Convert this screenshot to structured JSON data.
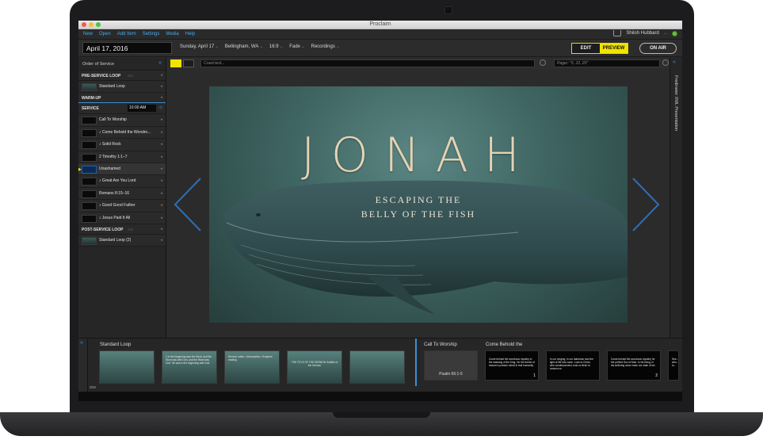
{
  "window": {
    "title": "Proclaim"
  },
  "menu": [
    "New",
    "Open",
    "Add Item",
    "Settings",
    "Media",
    "Help"
  ],
  "user": {
    "name": "Shiloh Hubbard"
  },
  "toolbar": {
    "date": "April 17, 2016",
    "service_date": "Sunday, April 17",
    "location": "Bellingham, WA",
    "aspect": "16:9",
    "transition": "Fade",
    "recordings": "Recordings",
    "edit_label": "EDIT",
    "preview_label": "PREVIEW",
    "onair_label": "ON AIR"
  },
  "sidebar": {
    "title": "Order of Service",
    "sections": {
      "pre": {
        "label": "PRE-SERVICE LOOP",
        "count": "45s"
      },
      "warmup": {
        "label": "WARM-UP"
      },
      "service": {
        "label": "SERVICE",
        "time": "10:00 AM"
      },
      "post": {
        "label": "POST-SERVICE LOOP",
        "count": "45s"
      }
    },
    "pre_items": [
      {
        "label": "Standard Loop",
        "count": "45s"
      }
    ],
    "service_items": [
      {
        "label": "Call To Worship"
      },
      {
        "label": "♪ Come Behold the Wondro..."
      },
      {
        "label": "♪ Solid Rock"
      },
      {
        "label": "2 Timothy 1:1–7"
      },
      {
        "label": "Unashamed"
      },
      {
        "label": "♪ Great Are You Lord"
      },
      {
        "label": "Romans 8:15–16"
      },
      {
        "label": "♪ Good Good Father"
      },
      {
        "label": "♪ Jesus Paid It All"
      }
    ],
    "post_items": [
      {
        "label": "Standard Loop (2)",
        "count": "45s"
      }
    ]
  },
  "preview_toolbar": {
    "crawl_placeholder": "Crawl text...",
    "pager_placeholder": "Pager: \"5, 10, 20\""
  },
  "slide": {
    "title": "JONAH",
    "subtitle_line1": "ESCAPING THE",
    "subtitle_line2": "BELLY OF THE FISH"
  },
  "right_panel": {
    "label": "Fredmeier XML Presentation"
  },
  "bottom": {
    "group1_label": "Standard Loop",
    "group2_label": "Call To Worship",
    "group3_label": "Come Behold the",
    "loop_thumbs": [
      {
        "text": ""
      },
      {
        "text": "1 In the beginning was the Word, and the Word was with God, and the Word was God. He was in the beginning with God."
      },
      {
        "text": "Sermon notes: • Introduction • Scripture reading"
      },
      {
        "text": "THE TITLE OF THE SERMON Subtitle of the Sermon"
      },
      {
        "text": ""
      }
    ],
    "service_thumbs": [
      {
        "text": "",
        "caption": "Psalm 66:1-5",
        "num": ""
      },
      {
        "text": "Come behold the wondrous mystery in the dawning of the King. He the theme of heaven's praises robed in frail humanity",
        "caption": "",
        "num": "1"
      },
      {
        "text": "In our longing, in our darkness now the light of life has come. Look to Christ, who condescended, took on flesh to ransom us",
        "caption": "",
        "num": ""
      },
      {
        "text": "Come behold the wondrous mystery he the perfect Son of Man. In his living, in his suffering never trace nor stain of sin",
        "caption": "",
        "num": "2"
      },
      {
        "text": "See... who... lo...",
        "caption": "",
        "num": ""
      }
    ]
  },
  "colors": {
    "accent_blue": "#47a8e6",
    "preview_yellow": "#f1e400",
    "status_green": "#6bbf3f"
  }
}
